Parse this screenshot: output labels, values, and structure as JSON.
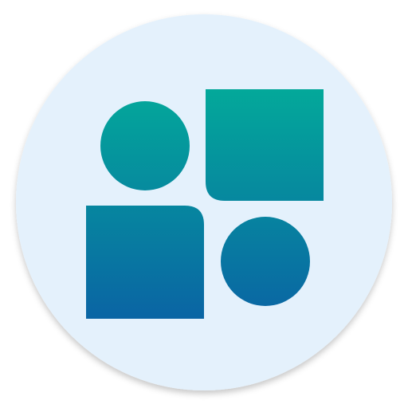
{
  "app_icon": {
    "icon_name": "shapes-grid-icon",
    "colors": {
      "background_circle": "#E4F1FC",
      "shape_gradient_top": "#03A99A",
      "shape_gradient_bottom": "#0A64A4"
    },
    "shapes": [
      {
        "name": "top-left-circle",
        "kind": "circle"
      },
      {
        "name": "top-right-square",
        "kind": "rounded-square"
      },
      {
        "name": "bottom-left-square",
        "kind": "rounded-square"
      },
      {
        "name": "bottom-right-circle",
        "kind": "circle"
      }
    ]
  }
}
